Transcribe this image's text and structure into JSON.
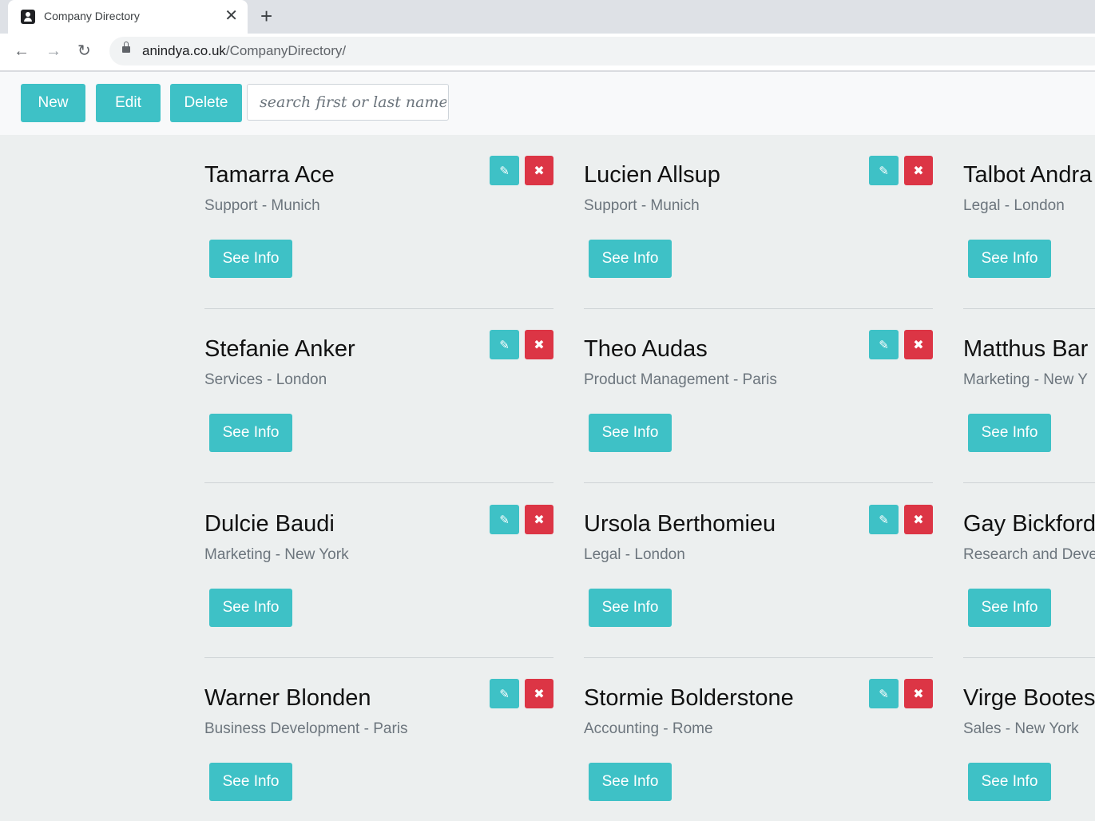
{
  "browser": {
    "tab_title": "Company Directory",
    "tab_close": "✕",
    "new_tab": "+",
    "back": "←",
    "forward": "→",
    "reload": "↻",
    "url_host": "anindya.co.uk",
    "url_path": "/CompanyDirectory/"
  },
  "appbar": {
    "new_label": "New",
    "edit_label": "Edit",
    "delete_label": "Delete",
    "search_placeholder": "search first or last name"
  },
  "accent_color": "#3ec1c6",
  "danger_color": "#dc3545",
  "see_info_label": "See Info",
  "edit_icon": "✎",
  "delete_icon": "✖",
  "employees": [
    {
      "name": "Tamarra Ace",
      "department": "Support",
      "location": "Munich",
      "subtitle": "Support - Munich"
    },
    {
      "name": "Lucien Allsup",
      "department": "Support",
      "location": "Munich",
      "subtitle": "Support - Munich"
    },
    {
      "name": "Talbot Andra",
      "department": "Legal",
      "location": "London",
      "subtitle": "Legal - London"
    },
    {
      "name": "Stefanie Anker",
      "department": "Services",
      "location": "London",
      "subtitle": "Services - London"
    },
    {
      "name": "Theo Audas",
      "department": "Product Management",
      "location": "Paris",
      "subtitle": "Product Management - Paris"
    },
    {
      "name": "Matthus Bar",
      "department": "Marketing",
      "location": "New Y",
      "subtitle": "Marketing - New Y"
    },
    {
      "name": "Dulcie Baudi",
      "department": "Marketing",
      "location": "New York",
      "subtitle": "Marketing - New York"
    },
    {
      "name": "Ursola Berthomieu",
      "department": "Legal",
      "location": "London",
      "subtitle": "Legal - London"
    },
    {
      "name": "Gay Bickford",
      "department": "Research and Deve",
      "location": "",
      "subtitle": "Research and Deve"
    },
    {
      "name": "Warner Blonden",
      "department": "Business Development",
      "location": "Paris",
      "subtitle": "Business Development - Paris"
    },
    {
      "name": "Stormie Bolderstone",
      "department": "Accounting",
      "location": "Rome",
      "subtitle": "Accounting - Rome"
    },
    {
      "name": "Virge Bootes",
      "department": "Sales",
      "location": "New York",
      "subtitle": "Sales - New York"
    }
  ]
}
